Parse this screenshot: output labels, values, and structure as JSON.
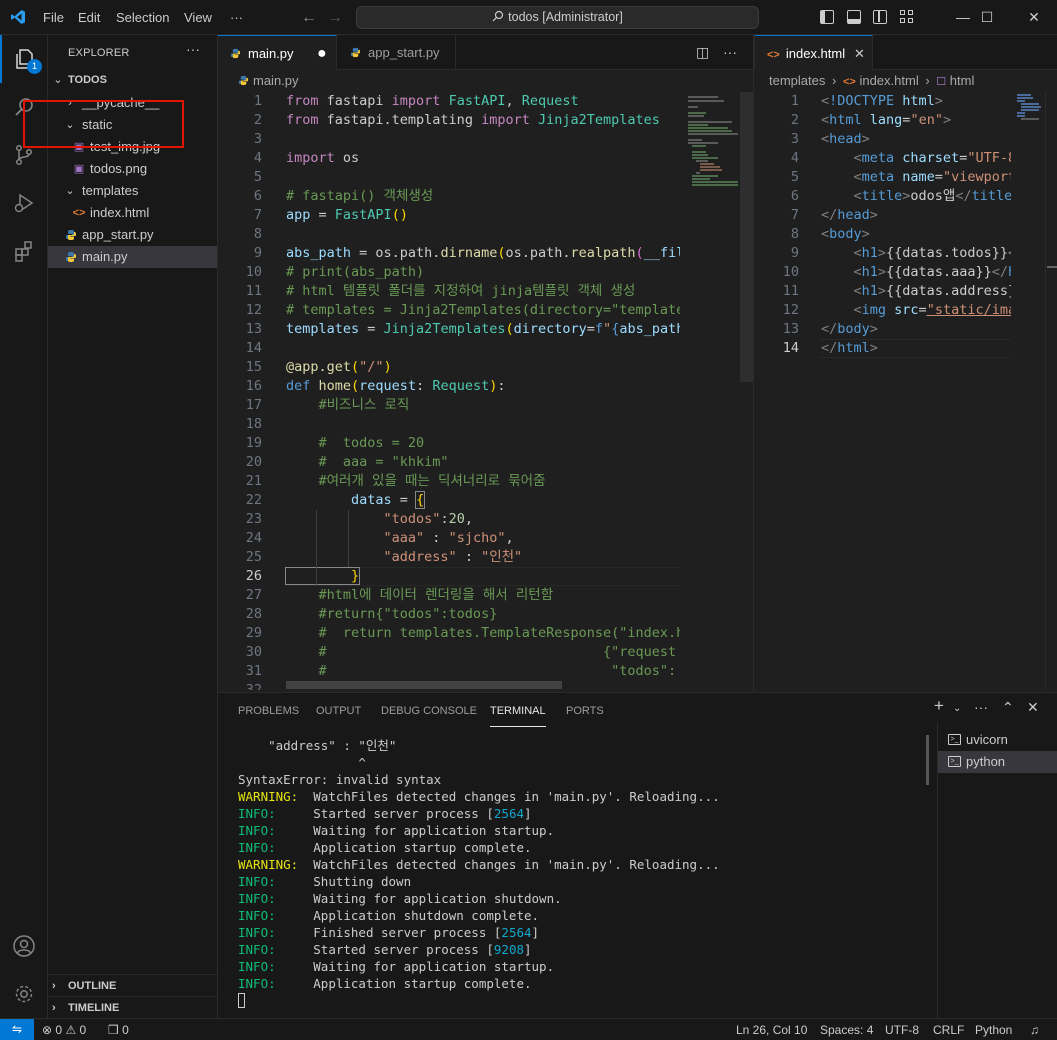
{
  "titlebar": {
    "menus": [
      "File",
      "Edit",
      "Selection",
      "View"
    ],
    "more": "···",
    "search_text": "todos [Administrator]"
  },
  "activity": {
    "explorer_badge": "1"
  },
  "sidebar": {
    "title": "EXPLORER",
    "more": "···",
    "root": "TODOS",
    "items": [
      {
        "label": "__pycache__"
      },
      {
        "label": "static"
      },
      {
        "label": "test_img.jpg"
      },
      {
        "label": "todos.png"
      },
      {
        "label": "templates"
      },
      {
        "label": "index.html"
      },
      {
        "label": "app_start.py"
      },
      {
        "label": "main.py"
      }
    ],
    "outline": "OUTLINE",
    "timeline": "TIMELINE"
  },
  "editor1": {
    "tabs": [
      {
        "label": "main.py"
      },
      {
        "label": "app_start.py"
      }
    ],
    "breadcrumb": "main.py",
    "line_numbers": [
      "1",
      "2",
      "3",
      "4",
      "5",
      "6",
      "7",
      "8",
      "9",
      "10",
      "11",
      "12",
      "13",
      "14",
      "15",
      "16",
      "17",
      "18",
      "19",
      "20",
      "21",
      "22",
      "23",
      "24",
      "25",
      "26",
      "27",
      "28",
      "29",
      "30",
      "31",
      "32"
    ],
    "current_line": 26
  },
  "editor2": {
    "tab": "index.html",
    "breadcrumb": [
      "templates",
      "index.html",
      "html"
    ],
    "line_numbers": [
      "1",
      "2",
      "3",
      "4",
      "5",
      "6",
      "7",
      "8",
      "9",
      "10",
      "11",
      "12",
      "13",
      "14"
    ],
    "current_line": 14
  },
  "panel": {
    "tabs": [
      "PROBLEMS",
      "OUTPUT",
      "DEBUG CONSOLE",
      "TERMINAL",
      "PORTS"
    ],
    "active_tab": "TERMINAL",
    "terminals": [
      "uvicorn",
      "python"
    ],
    "lines": [
      {
        "prefix": "",
        "text": "    \"address\" : \"인천\""
      },
      {
        "prefix": "",
        "text": "                ^"
      },
      {
        "prefix": "",
        "text": "SyntaxError: invalid syntax"
      },
      {
        "prefix": "WARNING:",
        "text": "  WatchFiles detected changes in 'main.py'. Reloading..."
      },
      {
        "prefix": "INFO:",
        "text": "     Started server process [",
        "num": "2564",
        "suffix": "]"
      },
      {
        "prefix": "INFO:",
        "text": "     Waiting for application startup."
      },
      {
        "prefix": "INFO:",
        "text": "     Application startup complete."
      },
      {
        "prefix": "WARNING:",
        "text": "  WatchFiles detected changes in 'main.py'. Reloading..."
      },
      {
        "prefix": "INFO:",
        "text": "     Shutting down"
      },
      {
        "prefix": "INFO:",
        "text": "     Waiting for application shutdown."
      },
      {
        "prefix": "INFO:",
        "text": "     Application shutdown complete."
      },
      {
        "prefix": "INFO:",
        "text": "     Finished server process [",
        "num": "2564",
        "suffix": "]"
      },
      {
        "prefix": "INFO:",
        "text": "     Started server process [",
        "num": "9208",
        "suffix": "]"
      },
      {
        "prefix": "INFO:",
        "text": "     Waiting for application startup."
      },
      {
        "prefix": "INFO:",
        "text": "     Application startup complete."
      }
    ]
  },
  "statusbar": {
    "errors": "0",
    "warnings": "0",
    "ports": "0",
    "position": "Ln 26, Col 10",
    "spaces": "Spaces: 4",
    "encoding": "UTF-8",
    "eol": "CRLF",
    "language": "Python"
  },
  "colors": {
    "accent": "#0078d4",
    "highlight_box": "#e51400",
    "terminal_warning": "#e5e510",
    "terminal_info": "#0dbc79"
  }
}
